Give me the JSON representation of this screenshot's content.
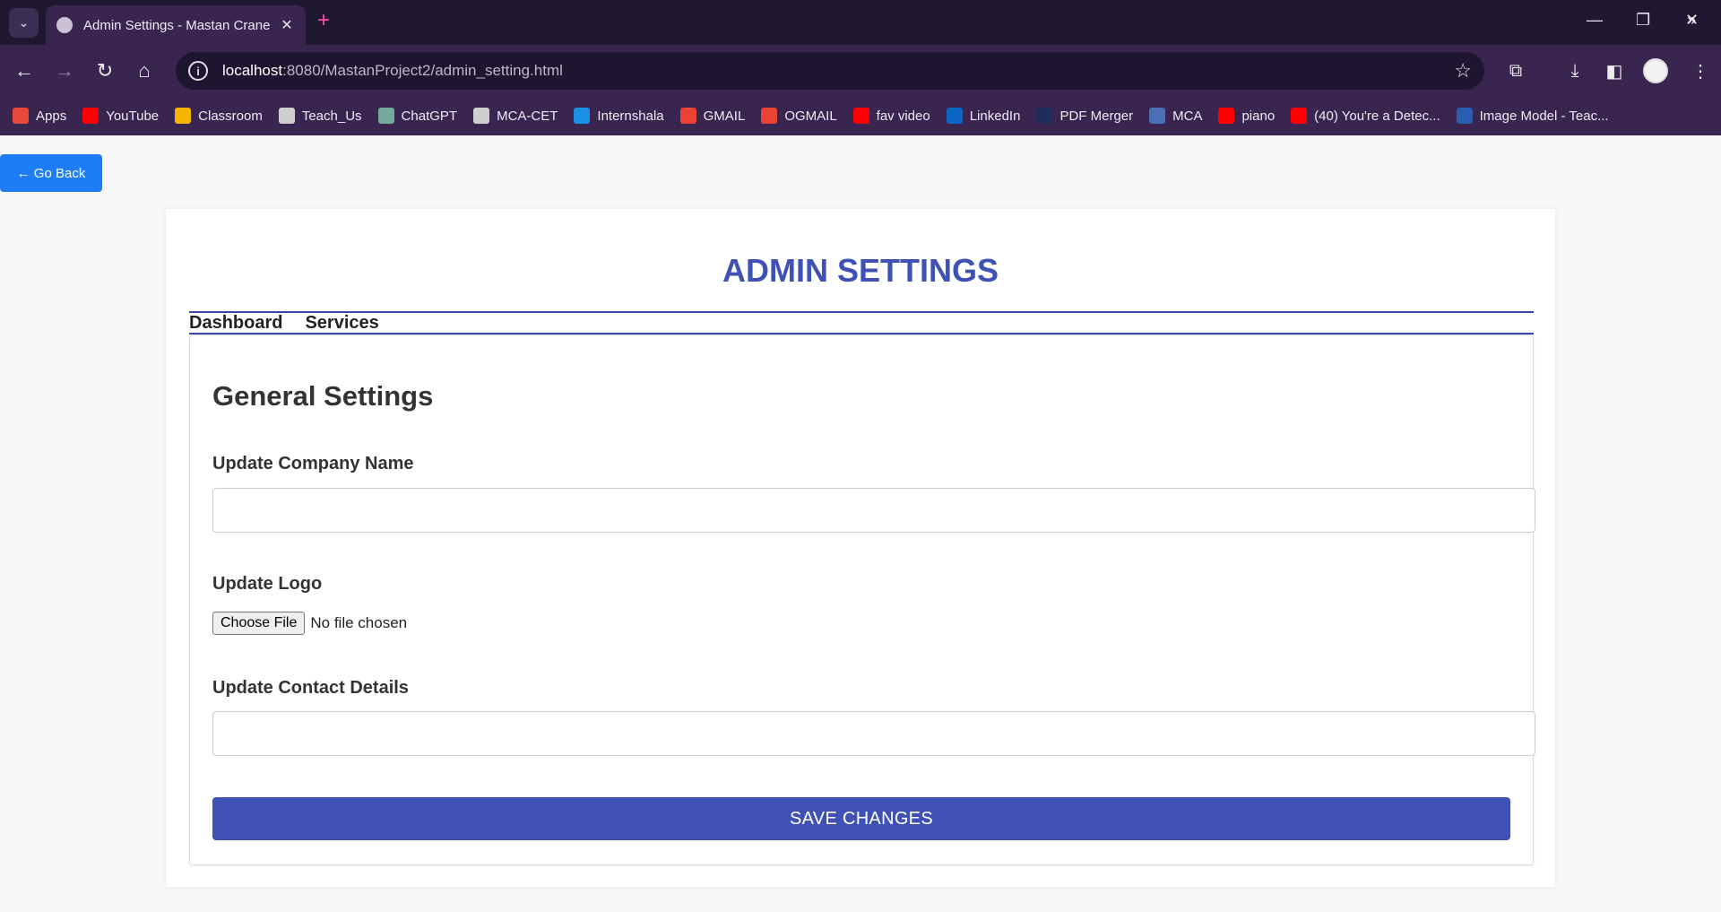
{
  "browser": {
    "tab_title": "Admin Settings - Mastan Crane",
    "url_host": "localhost",
    "url_rest": ":8080/MastanProject2/admin_setting.html",
    "bookmarks": [
      {
        "label": "Apps",
        "icon": "apps-grid-icon",
        "color": "#e8493b"
      },
      {
        "label": "YouTube",
        "icon": "youtube-icon",
        "color": "#ff0000"
      },
      {
        "label": "Classroom",
        "icon": "classroom-icon",
        "color": "#f5b400"
      },
      {
        "label": "Teach_Us",
        "icon": "globe-icon",
        "color": "#cfcfcf"
      },
      {
        "label": "ChatGPT",
        "icon": "chatgpt-icon",
        "color": "#74aa9c"
      },
      {
        "label": "MCA-CET",
        "icon": "globe-icon",
        "color": "#cfcfcf"
      },
      {
        "label": "Internshala",
        "icon": "internshala-icon",
        "color": "#1a8fe3"
      },
      {
        "label": "GMAIL",
        "icon": "gmail-icon",
        "color": "#ea4335"
      },
      {
        "label": "OGMAIL",
        "icon": "gmail-icon",
        "color": "#ea4335"
      },
      {
        "label": "fav video",
        "icon": "youtube-icon",
        "color": "#ff0000"
      },
      {
        "label": "LinkedIn",
        "icon": "linkedin-icon",
        "color": "#0a66c2"
      },
      {
        "label": "PDF Merger",
        "icon": "pdf-merger-icon",
        "color": "#1f2d5a"
      },
      {
        "label": "MCA",
        "icon": "cet-icon",
        "color": "#4a6fb5"
      },
      {
        "label": "piano",
        "icon": "youtube-icon",
        "color": "#ff0000"
      },
      {
        "label": "(40) You're a Detec...",
        "icon": "youtube-icon",
        "color": "#ff0000"
      },
      {
        "label": "Image Model - Teac...",
        "icon": "tm-icon",
        "color": "#2a5db0"
      }
    ]
  },
  "page": {
    "go_back": "← Go Back",
    "title": "ADMIN SETTINGS",
    "nav": [
      "Dashboard",
      "Services"
    ],
    "section_title": "General Settings",
    "company_label": "Update Company Name",
    "company_value": "",
    "logo_label": "Update Logo",
    "file_button": "Choose File",
    "file_status": "No file chosen",
    "contact_label": "Update Contact Details",
    "contact_value": "",
    "save_button": "SAVE CHANGES"
  }
}
